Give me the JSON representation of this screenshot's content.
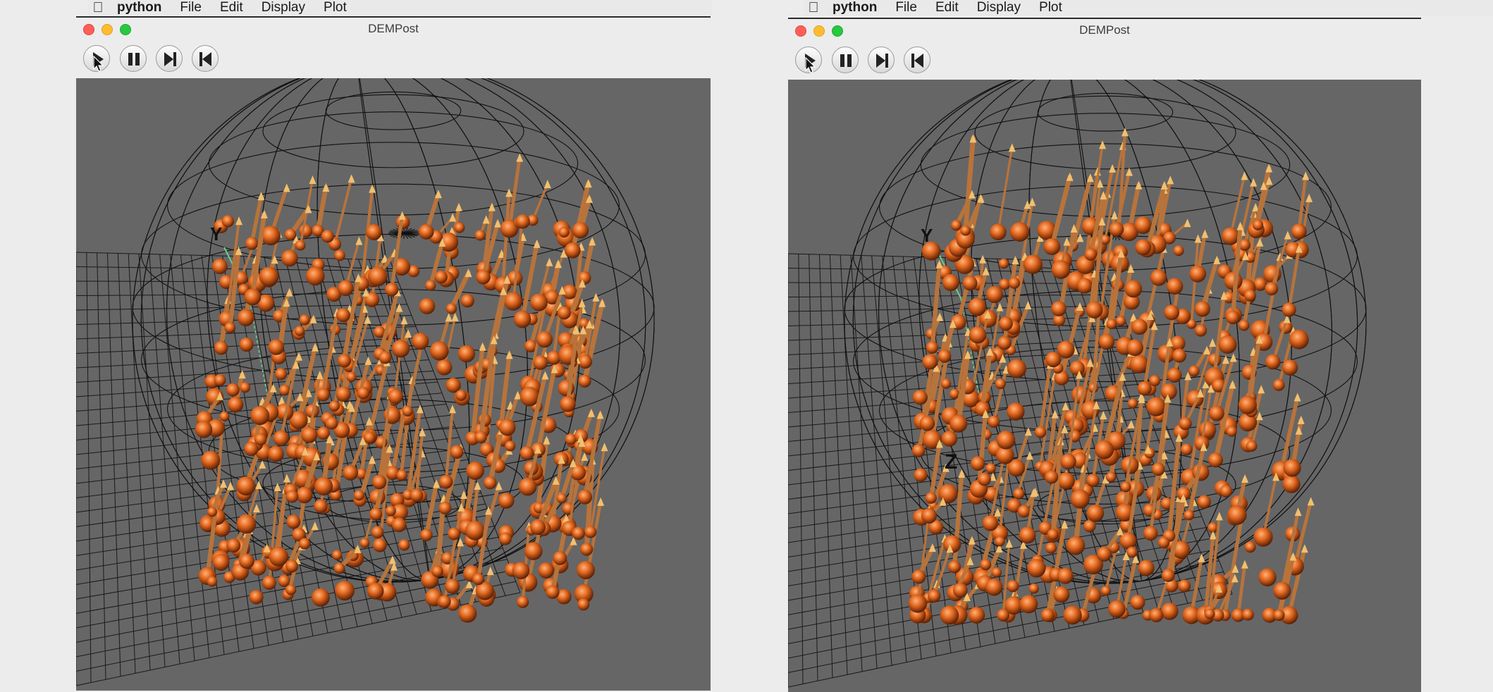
{
  "left": {
    "menubar": {
      "app_name": "python",
      "items": [
        "File",
        "Edit",
        "Display",
        "Plot"
      ]
    },
    "window": {
      "title": "DEMPost"
    },
    "toolbar": {
      "icons": [
        "play-icon",
        "pause-icon",
        "step-forward-icon",
        "step-back-icon"
      ]
    },
    "viewport": {
      "axis_label": "Y"
    }
  },
  "right": {
    "menubar": {
      "app_name": "python",
      "items": [
        "File",
        "Edit",
        "Display",
        "Plot"
      ]
    },
    "window": {
      "title": "DEMPost"
    },
    "toolbar": {
      "icons": [
        "play-icon",
        "pause-icon",
        "step-forward-icon",
        "step-back-icon"
      ]
    },
    "viewport": {
      "axis_label_y": "Y",
      "axis_label_z": "Z"
    }
  },
  "colors": {
    "viewport_bg": "#666666",
    "particle": "#e2681f",
    "velocity_arrow": "#b8733b",
    "arrow_head": "#f0c070",
    "wireframe": "#111111"
  }
}
